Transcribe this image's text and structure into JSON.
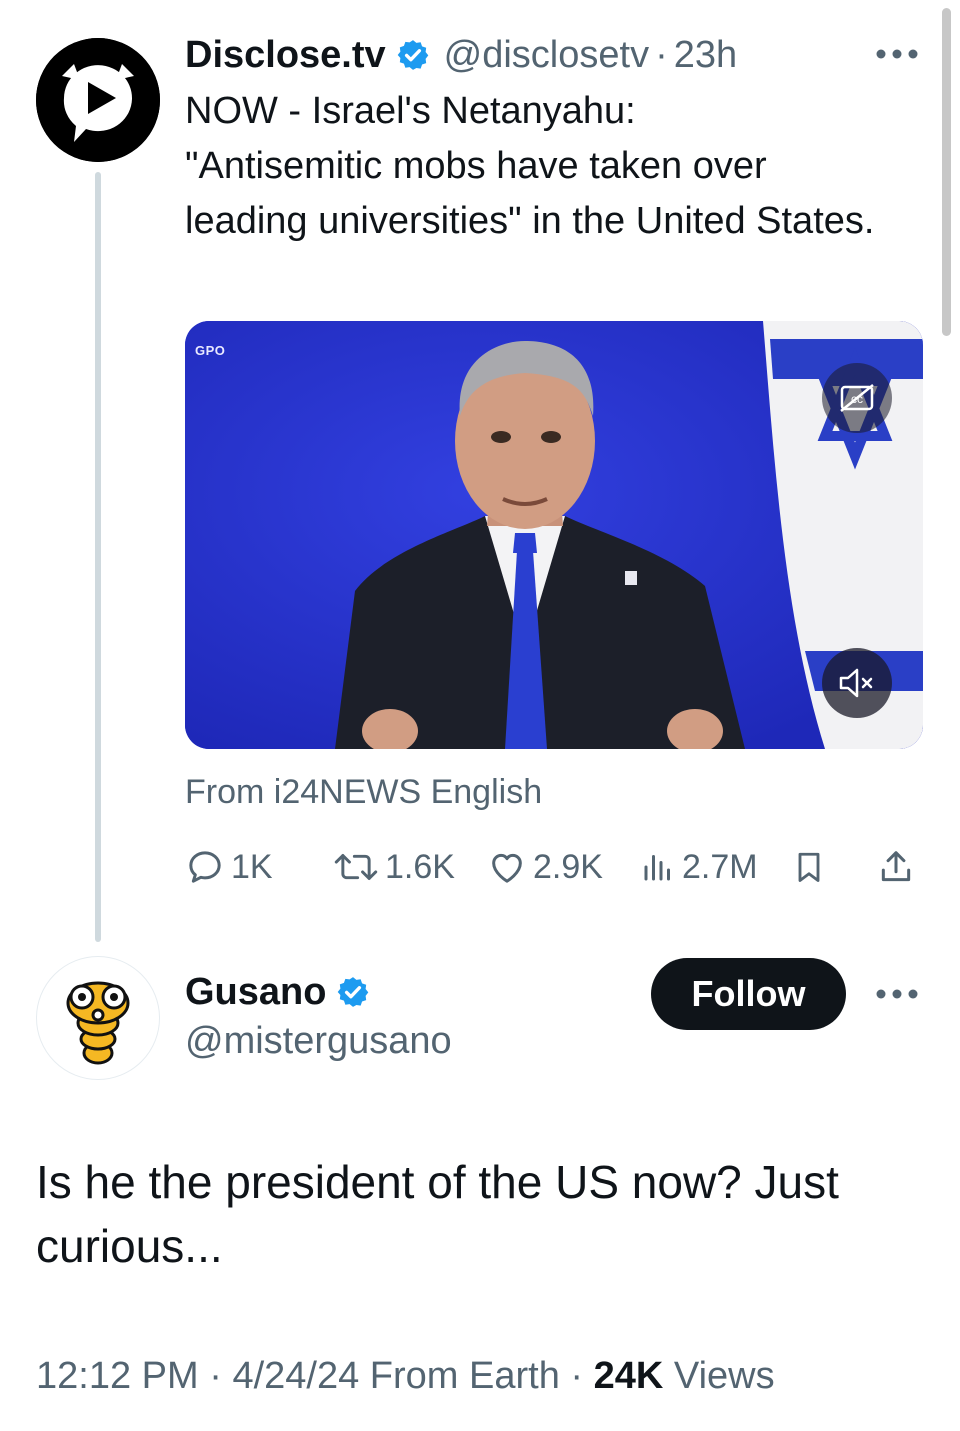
{
  "parent_tweet": {
    "display_name": "Disclose.tv",
    "handle": "@disclosetv",
    "time_ago": "23h",
    "text": "NOW - Israel's Netanyahu:\n\"Antisemitic mobs have taken over leading universities\" in the United States.",
    "media": {
      "watermark": "GPO",
      "cc_icon": "closed-captions-off-icon",
      "mute_icon": "speaker-muted-icon"
    },
    "source": "From i24NEWS English",
    "stats": {
      "replies": "1K",
      "reposts": "1.6K",
      "likes": "2.9K",
      "views": "2.7M"
    }
  },
  "reply_tweet": {
    "display_name": "Gusano",
    "handle": "@mistergusano",
    "follow_label": "Follow",
    "text": "Is he the president of the US now? Just curious...",
    "time": "12:12 PM",
    "date": "4/24/24",
    "from": "From Earth",
    "views_count": "24K",
    "views_label": "Views"
  },
  "colors": {
    "text": "#0f1419",
    "muted": "#536471",
    "verified": "#1d9bf0",
    "thread_line": "#cfd9de",
    "follow_bg": "#0f1419"
  }
}
